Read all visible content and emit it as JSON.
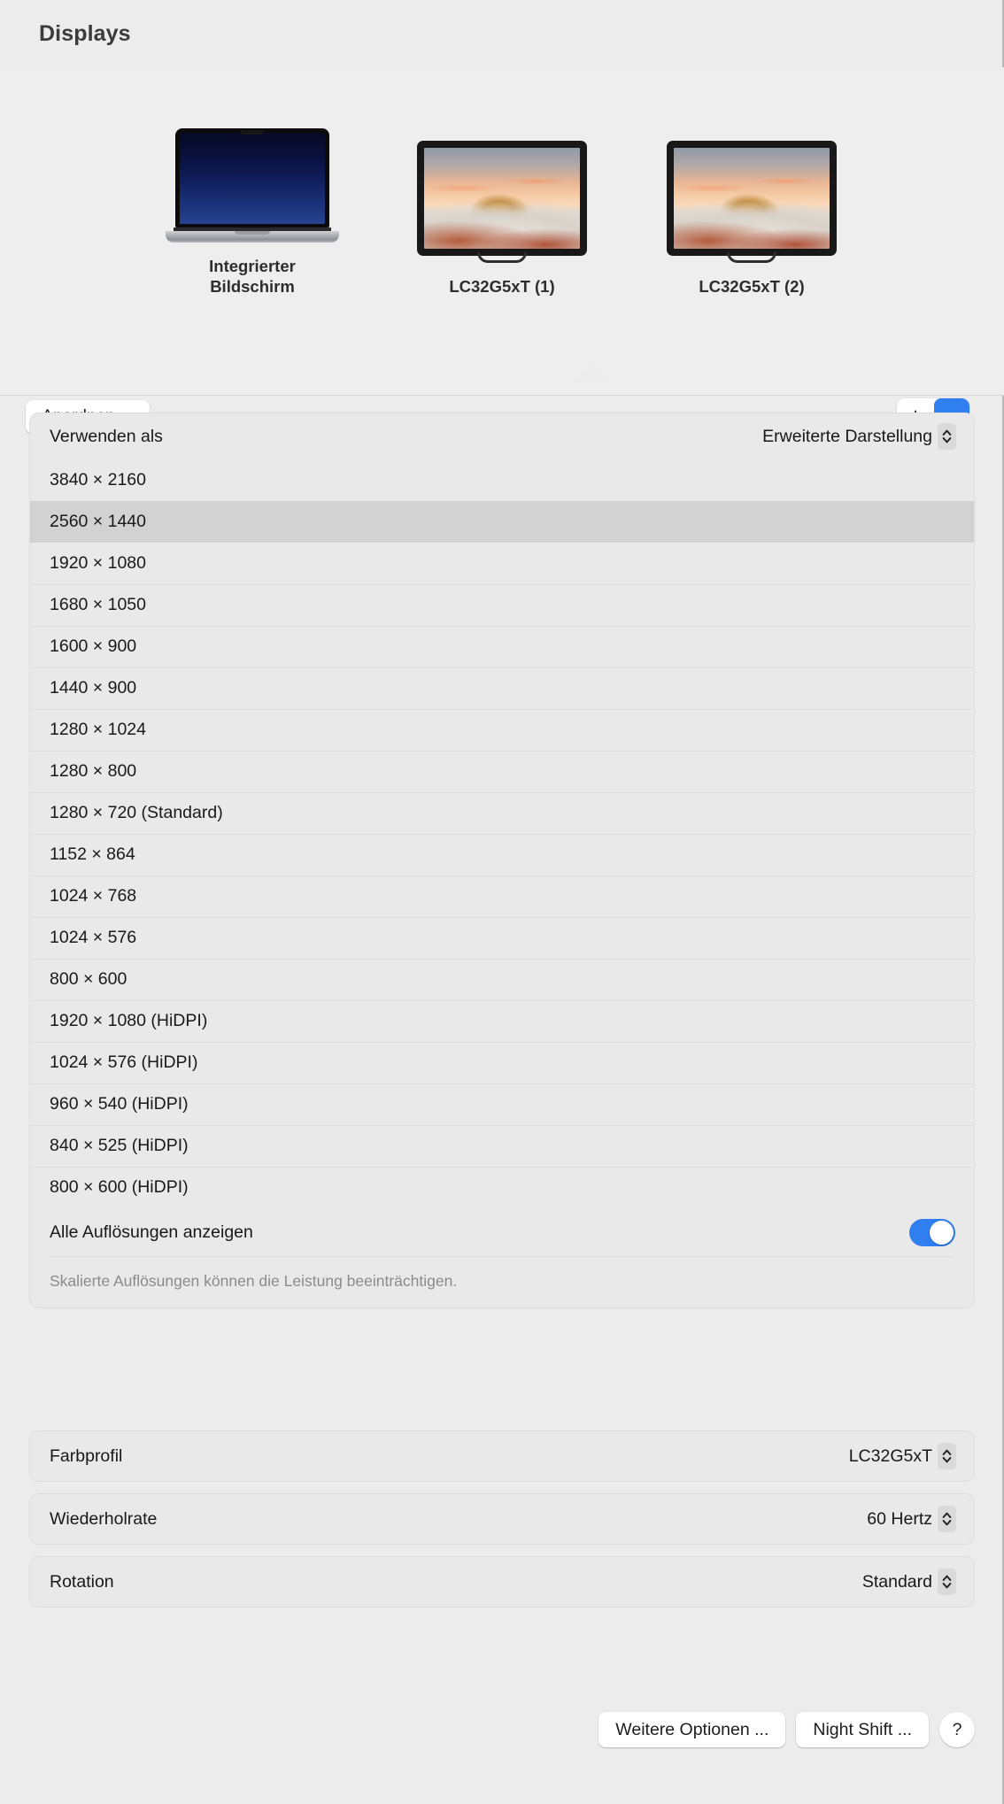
{
  "window": {
    "title": "Displays"
  },
  "chooser": {
    "arrange_button": "Anordnen ...",
    "add_button_icon": "plus-icon",
    "add_menu_icon": "chevron-down-icon",
    "displays": [
      {
        "name": "Integrierter\nBildschirm",
        "name_line1": "Integrierter",
        "name_line2": "Bildschirm",
        "kind": "laptop",
        "selected": false
      },
      {
        "name": "LC32G5xT (1)",
        "name_line1": "LC32G5xT (1)",
        "name_line2": "",
        "kind": "monitor",
        "selected": false
      },
      {
        "name": "LC32G5xT (2)",
        "name_line1": "LC32G5xT (2)",
        "name_line2": "",
        "kind": "monitor",
        "selected": true
      }
    ]
  },
  "use_as": {
    "label": "Verwenden als",
    "value": "Erweiterte Darstellung"
  },
  "resolutions": {
    "items": [
      {
        "label": "3840 × 2160",
        "selected": false
      },
      {
        "label": "2560 × 1440",
        "selected": true
      },
      {
        "label": "1920 × 1080",
        "selected": false
      },
      {
        "label": "1680 × 1050",
        "selected": false
      },
      {
        "label": "1600 × 900",
        "selected": false
      },
      {
        "label": "1440 × 900",
        "selected": false
      },
      {
        "label": "1280 × 1024",
        "selected": false
      },
      {
        "label": "1280 × 800",
        "selected": false
      },
      {
        "label": "1280 × 720 (Standard)",
        "selected": false
      },
      {
        "label": "1152 × 864",
        "selected": false
      },
      {
        "label": "1024 × 768",
        "selected": false
      },
      {
        "label": "1024 × 576",
        "selected": false
      },
      {
        "label": "800 × 600",
        "selected": false
      },
      {
        "label": "1920 × 1080 (HiDPI)",
        "selected": false
      },
      {
        "label": "1024 × 576 (HiDPI)",
        "selected": false
      },
      {
        "label": "960 × 540 (HiDPI)",
        "selected": false
      },
      {
        "label": "840 × 525 (HiDPI)",
        "selected": false
      },
      {
        "label": "800 × 600 (HiDPI)",
        "selected": false
      }
    ],
    "show_all_label": "Alle Auflösungen anzeigen",
    "show_all_on": true,
    "footnote": "Skalierte Auflösungen können die Leistung beeinträchtigen."
  },
  "color_profile": {
    "label": "Farbprofil",
    "value": "LC32G5xT"
  },
  "refresh_rate": {
    "label": "Wiederholrate",
    "value": "60 Hertz"
  },
  "rotation": {
    "label": "Rotation",
    "value": "Standard"
  },
  "footer": {
    "more_options": "Weitere Optionen ...",
    "night_shift": "Night Shift ...",
    "help": "?"
  },
  "colors": {
    "accent_blue": "#2f7ff0",
    "window_bg": "#ececec",
    "chooser_bg": "#eeeeee",
    "card_bg": "#e9e9e9",
    "selected_row": "#d2d2d2"
  }
}
